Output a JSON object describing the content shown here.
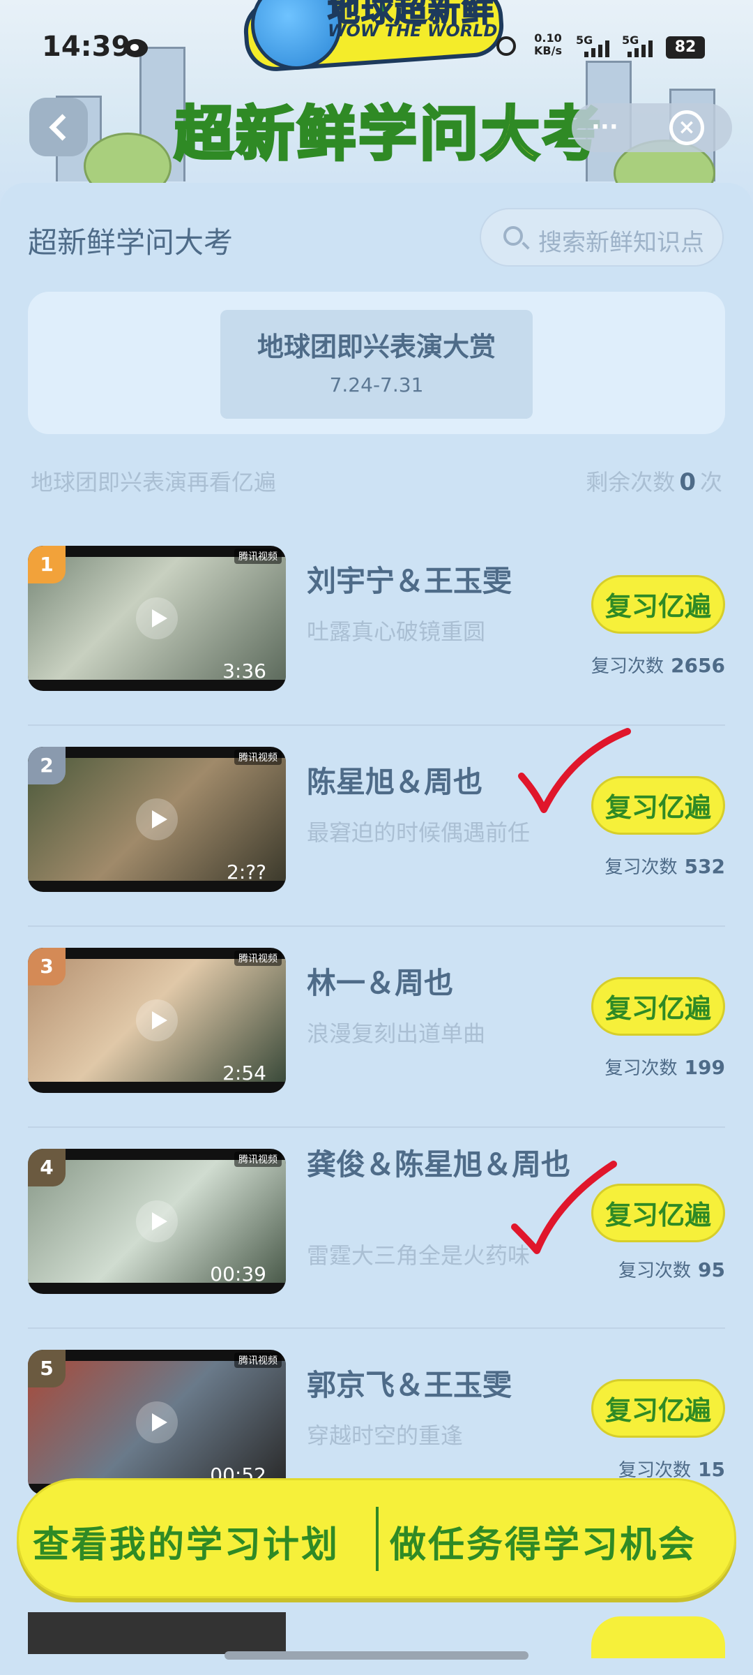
{
  "status_bar": {
    "time": "14:39",
    "net_speed_value": "0.10",
    "net_speed_unit": "KB/s",
    "signal_1": "5G",
    "signal_2": "5G",
    "battery": "82"
  },
  "header": {
    "logo_cn": "地球超新鲜",
    "logo_en": "WOW THE WORLD",
    "banner_title": "超新鲜学问大考",
    "more_label": "···"
  },
  "section": {
    "title": "超新鲜学问大考",
    "search_placeholder": "搜索新鲜知识点"
  },
  "event": {
    "name": "地球团即兴表演大赏",
    "date": "7.24-7.31"
  },
  "subheader": {
    "left": "地球团即兴表演再看亿遍",
    "remaining_prefix": "剩余次数",
    "remaining_value": "0",
    "remaining_suffix": "次"
  },
  "items": [
    {
      "rank": "1",
      "name": "刘宇宁＆王玉雯",
      "desc": "吐露真心破镜重圆",
      "duration": "3:36",
      "button": "复习亿遍",
      "count_label": "复习次数",
      "count": "2656",
      "rank_color": "#f2a23a",
      "thumb_tag": "腾讯视频"
    },
    {
      "rank": "2",
      "name": "陈星旭＆周也",
      "desc": "最窘迫的时候偶遇前任",
      "duration": "2:??",
      "button": "复习亿遍",
      "count_label": "复习次数",
      "count": "532",
      "rank_color": "#8a9aae",
      "thumb_tag": "腾讯视频"
    },
    {
      "rank": "3",
      "name": "林一＆周也",
      "desc": "浪漫复刻出道单曲",
      "duration": "2:54",
      "button": "复习亿遍",
      "count_label": "复习次数",
      "count": "199",
      "rank_color": "#d48a56",
      "thumb_tag": "腾讯视频"
    },
    {
      "rank": "4",
      "name": "龚俊＆陈星旭＆周也",
      "desc": "雷霆大三角全是火药味",
      "duration": "00:39",
      "button": "复习亿遍",
      "count_label": "复习次数",
      "count": "95",
      "rank_color": "#6b5a40",
      "thumb_tag": "腾讯视频"
    },
    {
      "rank": "5",
      "name": "郭京飞＆王玉雯",
      "desc": "穿越时空的重逢",
      "duration": "00:52",
      "button": "复习亿遍",
      "count_label": "复习次数",
      "count": "15",
      "rank_color": "#6b5a40",
      "thumb_tag": "腾讯视频"
    }
  ],
  "cta": {
    "left": "查看我的学习计划",
    "right": "做任务得学习机会"
  },
  "colors": {
    "accent_yellow": "#f6f03a",
    "accent_green": "#2f8a25",
    "text_blue": "#4e6b88",
    "check_red": "#e0162b"
  }
}
